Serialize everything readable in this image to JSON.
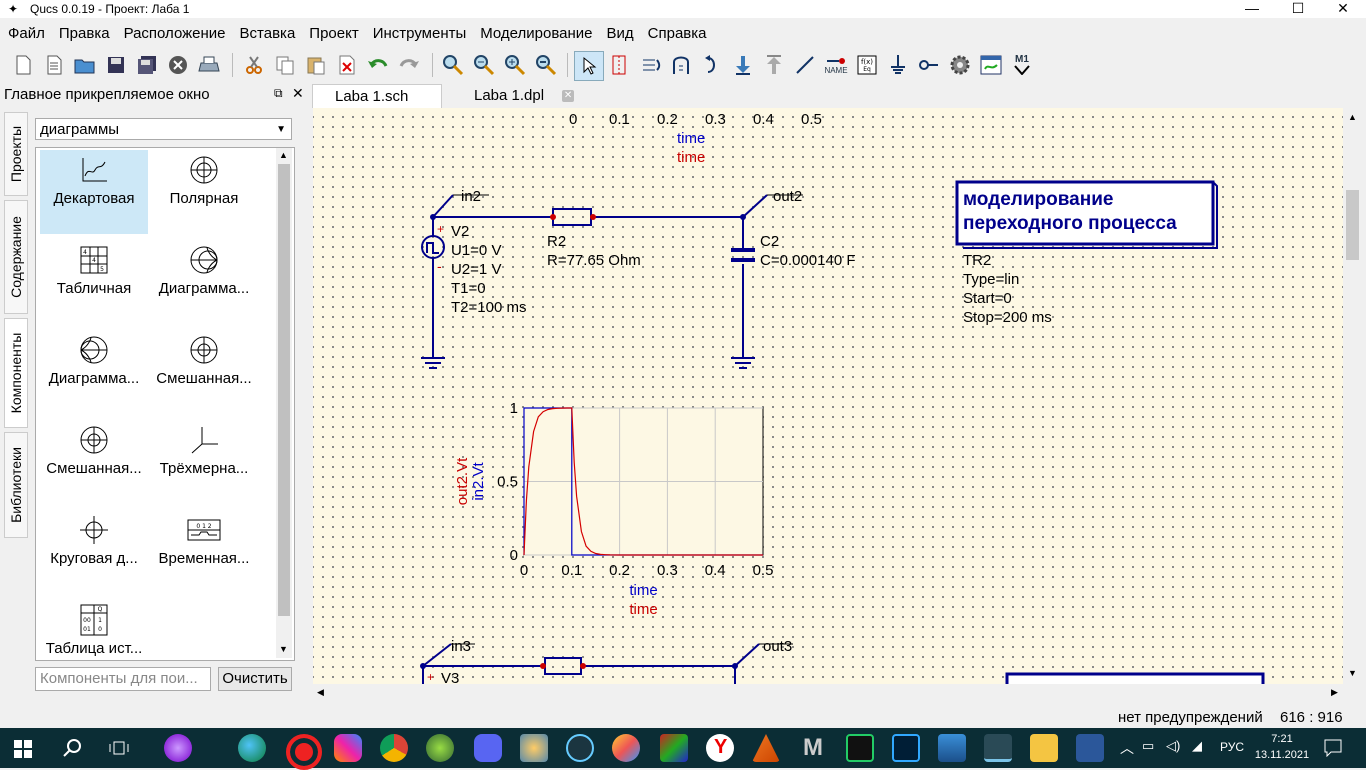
{
  "window": {
    "title": "Qucs 0.0.19 - Проект: Лаба 1"
  },
  "menu": [
    "Файл",
    "Правка",
    "Расположение",
    "Вставка",
    "Проект",
    "Инструменты",
    "Моделирование",
    "Вид",
    "Справка"
  ],
  "toolbar": {
    "icons": [
      "new-icon",
      "new-text-icon",
      "open-icon",
      "save-icon",
      "save-all-icon",
      "close-icon",
      "print-icon",
      "cut-icon",
      "copy-icon",
      "paste-icon",
      "delete-icon",
      "undo-icon",
      "redo-icon",
      "zoom-fit-icon",
      "zoom-select-icon",
      "zoom-in-icon",
      "zoom-out-icon",
      "select-icon",
      "mirror-icon",
      "rotate-icon",
      "align-icon",
      "wire-icon",
      "ground-icon",
      "port-icon",
      "move-down-icon",
      "move-up-icon",
      "line-icon",
      "name-label-icon",
      "equation-icon",
      "ground-symbol-icon",
      "port-symbol-icon",
      "simulate-icon",
      "view-data-icon",
      "marker-icon"
    ],
    "name_label": "NAME",
    "marker_label": "M1"
  },
  "dock": {
    "title": "Главное прикрепляемое окно",
    "side_tabs": [
      "Проекты",
      "Содержание",
      "Компоненты",
      "Библиотеки"
    ],
    "category": "диаграммы",
    "components": [
      "Декартовая",
      "Полярная",
      "Табличная",
      "Диаграмма...",
      "Диаграмма...",
      "Смешанная...",
      "Смешанная...",
      "Трёхмерна...",
      "Круговая д...",
      "Временная...",
      "Таблица ист..."
    ],
    "search_placeholder": "Компоненты для пои...",
    "clear_label": "Очистить"
  },
  "tabs": [
    {
      "label": "Laba 1.sch"
    },
    {
      "label": "Laba 1.dpl"
    }
  ],
  "schematic": {
    "top_axis": {
      "ticks": [
        "0",
        "0.1",
        "0.2",
        "0.3",
        "0.4",
        "0.5"
      ],
      "label_blue": "time",
      "label_red": "time"
    },
    "in_label": "in2",
    "out_label": "out2",
    "source": {
      "name": "V2",
      "plus": "+",
      "minus": "-",
      "params": [
        "U1=0 V",
        "U2=1 V",
        "T1=0",
        "T2=100 ms"
      ]
    },
    "resistor": {
      "name": "R2",
      "value": "R=77.65 Ohm"
    },
    "capacitor": {
      "name": "C2",
      "value": "C=0.000140 F"
    },
    "textbox": {
      "line1": "моделирование",
      "line2": "переходного процесса"
    },
    "transient": {
      "name": "TR2",
      "params": [
        "Type=lin",
        "Start=0",
        "Stop=200 ms"
      ]
    },
    "in3_label": "in3",
    "out3_label": "out3",
    "source3": {
      "name": "V3",
      "plus": "+"
    }
  },
  "chart_data": {
    "type": "line",
    "x_ticks": [
      "0",
      "0.1",
      "0.2",
      "0.3",
      "0.4",
      "0.5"
    ],
    "y_ticks": [
      "0",
      "0.5",
      "1"
    ],
    "xlim": [
      0,
      0.5
    ],
    "ylim": [
      0,
      1
    ],
    "xlabel_blue": "time",
    "xlabel_red": "time",
    "ylabel_red": "out2.Vt",
    "ylabel_blue": "in2.Vt",
    "grid": true,
    "series": [
      {
        "name": "in2.Vt",
        "color": "#0000c8",
        "x": [
          0,
          0,
          0.1,
          0.1,
          0.5
        ],
        "y": [
          0,
          1,
          1,
          0,
          0
        ]
      },
      {
        "name": "out2.Vt",
        "color": "#d40000",
        "x": [
          0,
          0.005,
          0.01,
          0.02,
          0.03,
          0.04,
          0.05,
          0.06,
          0.07,
          0.08,
          0.09,
          0.1,
          0.105,
          0.11,
          0.12,
          0.13,
          0.14,
          0.15,
          0.16,
          0.17,
          0.18,
          0.2,
          0.5
        ],
        "y": [
          0,
          0.37,
          0.6,
          0.84,
          0.94,
          0.975,
          0.99,
          0.996,
          0.998,
          0.999,
          1,
          1,
          0.63,
          0.4,
          0.16,
          0.06,
          0.025,
          0.01,
          0.004,
          0.002,
          0.001,
          0,
          0
        ]
      }
    ]
  },
  "status": {
    "warnings": "нет предупреждений",
    "coords": "616 : 916"
  },
  "tray": {
    "lang": "РУС",
    "time": "7:21",
    "date": "13.11.2021"
  }
}
